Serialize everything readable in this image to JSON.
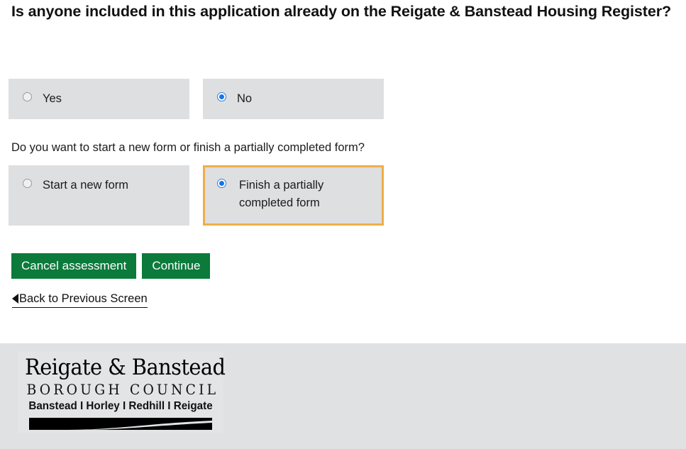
{
  "heading": "Is anyone included in this application already on the Reigate & Banstead Housing Register?",
  "question1": {
    "options": [
      {
        "label": "Yes",
        "selected": false
      },
      {
        "label": "No",
        "selected": true
      }
    ]
  },
  "question2": {
    "prompt": "Do you want to start a new form or finish a partially completed form?",
    "options": [
      {
        "label": "Start a new form",
        "selected": false,
        "focused": false
      },
      {
        "label": "Finish a partially completed form",
        "selected": true,
        "focused": true
      }
    ]
  },
  "buttons": {
    "cancel_label": "Cancel assessment",
    "continue_label": "Continue"
  },
  "back_link": {
    "label": "Back to Previous Screen"
  },
  "footer": {
    "logo": {
      "line1": "Reigate & Banstead",
      "line2": "BOROUGH COUNCIL",
      "line3": "Banstead I Horley I Redhill I Reigate"
    }
  },
  "colors": {
    "button_green": "#0b7a3b",
    "focus_outline": "#efae48",
    "option_background": "#dedfe0",
    "radio_selected": "#1a73e8",
    "footer_background": "#e0e1e2"
  }
}
